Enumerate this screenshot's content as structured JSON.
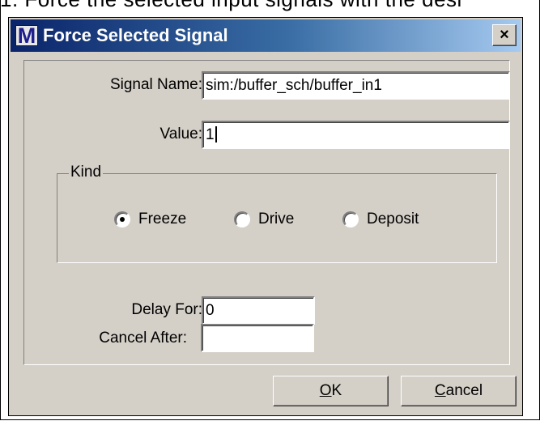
{
  "background_caption": "1. Force the selected input signals with the desi",
  "dialog": {
    "title": "Force Selected Signal",
    "close_symbol": "×",
    "icon_letter": "M"
  },
  "fields": {
    "signal_name": {
      "label": "Signal Name:",
      "value": "sim:/buffer_sch/buffer_in1"
    },
    "value": {
      "label": "Value:",
      "value": "1"
    },
    "delay_for": {
      "label": "Delay For:",
      "value": "0"
    },
    "cancel_after": {
      "label": "Cancel After:",
      "value": ""
    }
  },
  "kind": {
    "legend": "Kind",
    "selected": "Freeze",
    "options": [
      {
        "label": "Freeze",
        "checked": true
      },
      {
        "label": "Drive",
        "checked": false
      },
      {
        "label": "Deposit",
        "checked": false
      }
    ]
  },
  "buttons": {
    "ok": {
      "mnemonic": "O",
      "rest": "K"
    },
    "cancel": {
      "mnemonic": "C",
      "rest": "ancel"
    }
  },
  "colors": {
    "dialog_face": "#d4d0c8",
    "titlebar_start": "#0a246a",
    "titlebar_end": "#a6caf0"
  }
}
